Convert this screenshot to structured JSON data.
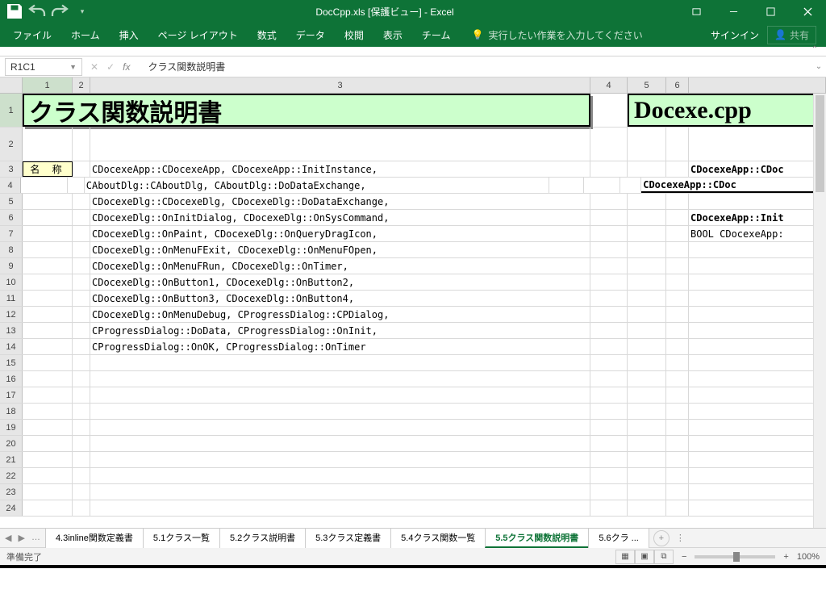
{
  "title_center": "DocCpp.xls  [保護ビュー] - Excel",
  "ribbon": {
    "tabs": [
      "ファイル",
      "ホーム",
      "挿入",
      "ページ レイアウト",
      "数式",
      "データ",
      "校閲",
      "表示",
      "チーム"
    ],
    "tell_me": "実行したい作業を入力してください",
    "signin": "サインイン",
    "share": "共有"
  },
  "name_box": "R1C1",
  "formula": "クラス関数説明書",
  "columns": [
    "1",
    "2",
    "3",
    "4",
    "5",
    "6"
  ],
  "col_widths": {
    "c1": 62,
    "c2": 22,
    "c3": 620,
    "c4": 46,
    "c5": 48,
    "c6": 28
  },
  "title_cell": "クラス関数説明書",
  "title_right": "Docexe.cpp",
  "label_name": "名 称",
  "data_rows": [
    "CDocexeApp::CDocexeApp, CDocexeApp::InitInstance,",
    "CAboutDlg::CAboutDlg, CAboutDlg::DoDataExchange,",
    "CDocexeDlg::CDocexeDlg, CDocexeDlg::DoDataExchange,",
    "CDocexeDlg::OnInitDialog, CDocexeDlg::OnSysCommand,",
    "CDocexeDlg::OnPaint, CDocexeDlg::OnQueryDragIcon,",
    "CDocexeDlg::OnMenuFExit, CDocexeDlg::OnMenuFOpen,",
    "CDocexeDlg::OnMenuFRun, CDocexeDlg::OnTimer,",
    "CDocexeDlg::OnButton1, CDocexeDlg::OnButton2,",
    "CDocexeDlg::OnButton3, CDocexeDlg::OnButton4,",
    "CDocexeDlg::OnMenuDebug, CProgressDialog::CPDialog,",
    "CProgressDialog::DoData, CProgressDialog::OnInit,",
    "CProgressDialog::OnOK, CProgressDialog::OnTimer"
  ],
  "right_rows": {
    "r3": "CDocexeApp::CDoc",
    "r4": "CDocexeApp::CDoc",
    "r6": "CDocexeApp::Init",
    "r7": "BOOL CDocexeApp:"
  },
  "sheet_tabs": [
    "4.3inline関数定義書",
    "5.1クラス一覧",
    "5.2クラス説明書",
    "5.3クラス定義書",
    "5.4クラス関数一覧",
    "5.5クラス関数説明書",
    "5.6クラ ..."
  ],
  "active_tab": "5.5クラス関数説明書",
  "status_left": "準備完了",
  "zoom": "100%"
}
